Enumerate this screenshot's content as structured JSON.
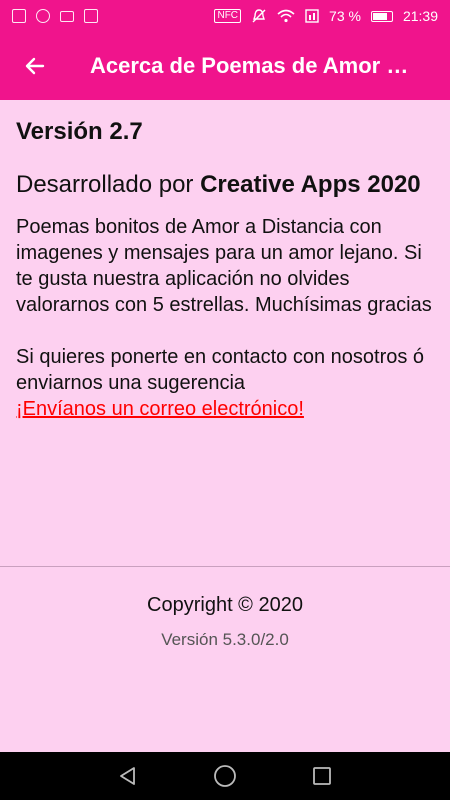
{
  "status_bar": {
    "battery_percent": "73 %",
    "time": "21:39",
    "nfc": "NFC",
    "icons": [
      "image-icon",
      "chrome-icon",
      "gmail-icon",
      "game-icon",
      "nfc-icon",
      "mute-icon",
      "wifi-icon",
      "signal-icon",
      "battery-icon"
    ]
  },
  "app_bar": {
    "title": "Acerca de Poemas de Amor a Distancia",
    "back_icon": "arrow-left-icon",
    "background": "#f0148c"
  },
  "content": {
    "version_title": "Versión 2.7",
    "developer_prefix": "Desarrollado por ",
    "developer_name": "Creative Apps 2020",
    "description": "Poemas bonitos de Amor a Distancia con imagenes y mensajes para un amor lejano. Si te gusta nuestra aplicación no olvides valorarnos con 5 estrellas. Muchísimas gracias",
    "contact_text": "Si quieres ponerte en contacto con nosotros ó enviarnos una sugerencia",
    "email_link": "¡Envíanos un correo electrónico!"
  },
  "footer": {
    "copyright": "Copyright © 2020",
    "app_version": "Versión 5.3.0/2.0"
  },
  "nav_bar": {
    "icons": [
      "back-triangle-icon",
      "home-circle-icon",
      "recents-square-icon"
    ]
  },
  "colors": {
    "accent": "#f0148c",
    "background": "#fdd0f0",
    "link": "#ff0000"
  }
}
